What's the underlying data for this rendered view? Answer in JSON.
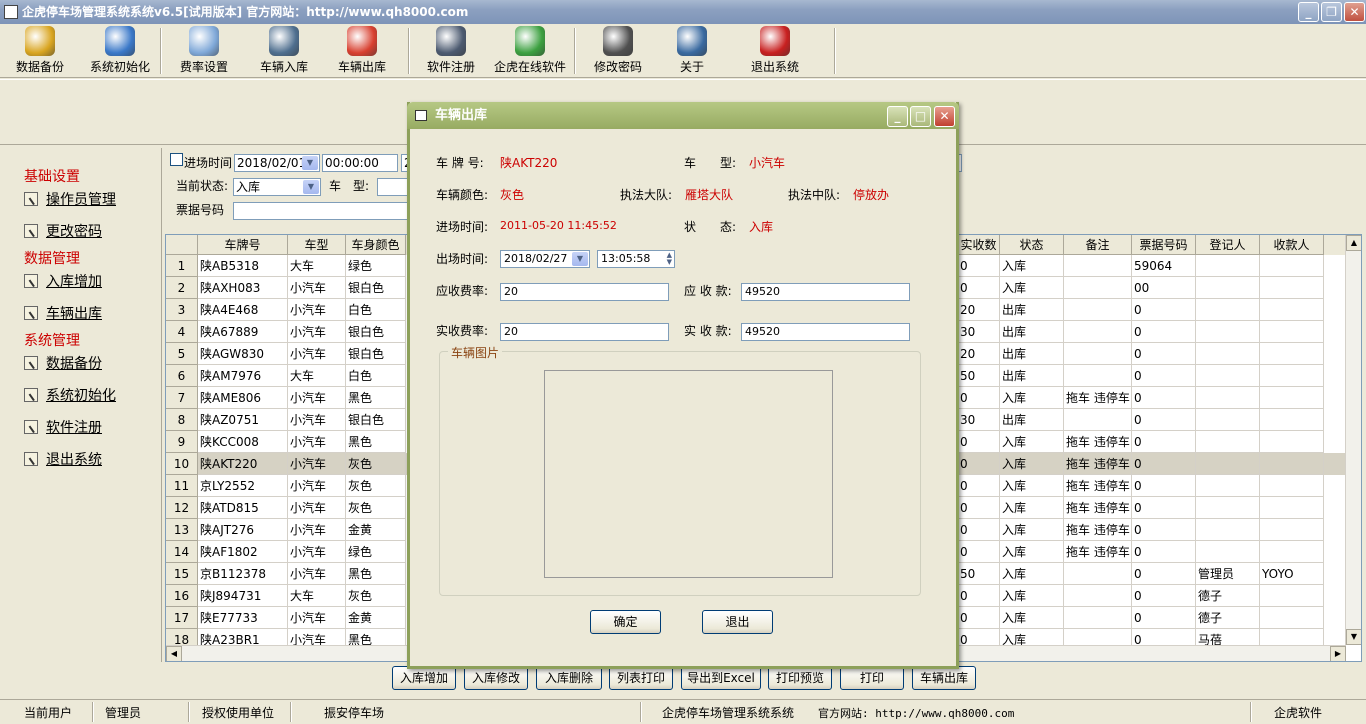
{
  "window": {
    "title": "企虎停车场管理系统系统v6.5[试用版本] 官方网站：http://www.qh8000.com"
  },
  "toolbar": {
    "items": [
      {
        "label": "数据备份",
        "icon": "database-icon",
        "color": "#d9a520"
      },
      {
        "label": "系统初始化",
        "icon": "init-icon",
        "color": "#3a78c8"
      },
      {
        "label": "费率设置",
        "icon": "magnifier-icon",
        "color": "#7fa8d8"
      },
      {
        "label": "车辆入库",
        "icon": "car-in-icon",
        "color": "#4f6f8f"
      },
      {
        "label": "车辆出库",
        "icon": "car-out-icon",
        "color": "#d84030"
      },
      {
        "label": "软件注册",
        "icon": "register-icon",
        "color": "#4c5a70"
      },
      {
        "label": "企虎在线软件",
        "icon": "refresh-icon",
        "color": "#3ca040"
      },
      {
        "label": "修改密码",
        "icon": "key-icon",
        "color": "#505050"
      },
      {
        "label": "关于",
        "icon": "about-icon",
        "color": "#3a6aa0"
      },
      {
        "label": "退出系统",
        "icon": "exit-icon",
        "color": "#c82020"
      }
    ]
  },
  "sidebar": {
    "sections": [
      {
        "title": "基础设置",
        "items": [
          "操作员管理",
          "更改密码"
        ]
      },
      {
        "title": "数据管理",
        "items": [
          "入库增加",
          "车辆出库"
        ]
      },
      {
        "title": "系统管理",
        "items": [
          "数据备份",
          "系统初始化",
          "软件注册",
          "退出系统"
        ]
      }
    ]
  },
  "filter": {
    "entry_time_label": "进场时间",
    "entry_date": "2018/02/01",
    "entry_time": "00:00:00",
    "entry_date2_partial": "2",
    "status_label": "当前状态:",
    "status_value": "入库",
    "type_label": "车　型:",
    "ticket_label": "票据号码"
  },
  "grid": {
    "columns_left": [
      "车牌号",
      "车型",
      "车身颜色"
    ],
    "columns_right": [
      "实收数",
      "状态",
      "备注",
      "票据号码",
      "登记人",
      "收款人"
    ],
    "rows": [
      {
        "n": "1",
        "plate": "陕AB5318",
        "type": "大车",
        "color": "绿色",
        "paid": "0",
        "status": "入库",
        "note": "",
        "ticket": "59064",
        "reg": "",
        "cashier": ""
      },
      {
        "n": "2",
        "plate": "陕AXH083",
        "type": "小汽车",
        "color": "银白色",
        "paid": "0",
        "status": "入库",
        "note": "",
        "ticket": "00",
        "reg": "",
        "cashier": ""
      },
      {
        "n": "3",
        "plate": "陕A4E468",
        "type": "小汽车",
        "color": "白色",
        "paid": "20",
        "status": "出库",
        "note": "",
        "ticket": "0",
        "reg": "",
        "cashier": ""
      },
      {
        "n": "4",
        "plate": "陕A67889",
        "type": "小汽车",
        "color": "银白色",
        "paid": "30",
        "status": "出库",
        "note": "",
        "ticket": "0",
        "reg": "",
        "cashier": ""
      },
      {
        "n": "5",
        "plate": "陕AGW830",
        "type": "小汽车",
        "color": "银白色",
        "paid": "20",
        "status": "出库",
        "note": "",
        "ticket": "0",
        "reg": "",
        "cashier": ""
      },
      {
        "n": "6",
        "plate": "陕AM7976",
        "type": "大车",
        "color": "白色",
        "paid": "50",
        "status": "出库",
        "note": "",
        "ticket": "0",
        "reg": "",
        "cashier": ""
      },
      {
        "n": "7",
        "plate": "陕AME806",
        "type": "小汽车",
        "color": "黑色",
        "paid": "0",
        "status": "入库",
        "note": "拖车 违停车",
        "ticket": "0",
        "reg": "",
        "cashier": ""
      },
      {
        "n": "8",
        "plate": "陕AZ0751",
        "type": "小汽车",
        "color": "银白色",
        "paid": "30",
        "status": "出库",
        "note": "",
        "ticket": "0",
        "reg": "",
        "cashier": ""
      },
      {
        "n": "9",
        "plate": "陕KCC008",
        "type": "小汽车",
        "color": "黑色",
        "paid": "0",
        "status": "入库",
        "note": "拖车 违停车",
        "ticket": "0",
        "reg": "",
        "cashier": ""
      },
      {
        "n": "10",
        "plate": "陕AKT220",
        "type": "小汽车",
        "color": "灰色",
        "paid": "0",
        "status": "入库",
        "note": "拖车 违停车",
        "ticket": "0",
        "reg": "",
        "cashier": ""
      },
      {
        "n": "11",
        "plate": "京LY2552",
        "type": "小汽车",
        "color": "灰色",
        "paid": "0",
        "status": "入库",
        "note": "拖车 违停车",
        "ticket": "0",
        "reg": "",
        "cashier": ""
      },
      {
        "n": "12",
        "plate": "陕ATD815",
        "type": "小汽车",
        "color": "灰色",
        "paid": "0",
        "status": "入库",
        "note": "拖车 违停车",
        "ticket": "0",
        "reg": "",
        "cashier": ""
      },
      {
        "n": "13",
        "plate": "陕AJT276",
        "type": "小汽车",
        "color": "金黄",
        "paid": "0",
        "status": "入库",
        "note": "拖车 违停车",
        "ticket": "0",
        "reg": "",
        "cashier": ""
      },
      {
        "n": "14",
        "plate": "陕AF1802",
        "type": "小汽车",
        "color": "绿色",
        "paid": "0",
        "status": "入库",
        "note": "拖车 违停车",
        "ticket": "0",
        "reg": "",
        "cashier": ""
      },
      {
        "n": "15",
        "plate": "京B112378",
        "type": "小汽车",
        "color": "黑色",
        "paid": "50",
        "status": "入库",
        "note": "",
        "ticket": "0",
        "reg": "管理员",
        "cashier": "YOYO"
      },
      {
        "n": "16",
        "plate": "陕J894731",
        "type": "大车",
        "color": "灰色",
        "paid": "0",
        "status": "入库",
        "note": "",
        "ticket": "0",
        "reg": "德子",
        "cashier": ""
      },
      {
        "n": "17",
        "plate": "陕E77733",
        "type": "小汽车",
        "color": "金黄",
        "paid": "0",
        "status": "入库",
        "note": "",
        "ticket": "0",
        "reg": "德子",
        "cashier": ""
      },
      {
        "n": "18",
        "plate": "陕A23BR1",
        "type": "小汽车",
        "color": "黑色",
        "paid": "0",
        "status": "入库",
        "note": "",
        "ticket": "0",
        "reg": "马蓓",
        "cashier": ""
      }
    ]
  },
  "bottom_buttons": [
    "入库增加",
    "入库修改",
    "入库删除",
    "列表打印",
    "导出到Excel",
    "打印预览",
    "打印",
    "车辆出库"
  ],
  "statusbar": {
    "current_user_label": "当前用户",
    "current_user": "管理员",
    "licensee_label": "授权使用单位",
    "licensee": "振安停车场",
    "product": "企虎停车场管理系统系统",
    "website": "官方网站: http://www.qh8000.com",
    "vendor": "企虎软件"
  },
  "dialog": {
    "title": "车辆出库",
    "plate_label": "车 牌 号:",
    "plate": "陕AKT220",
    "type_label": "车　　型:",
    "type": "小汽车",
    "color_label": "车辆颜色:",
    "color": "灰色",
    "brigade_label": "执法大队:",
    "brigade": "雁塔大队",
    "squad_label": "执法中队:",
    "squad": "停放办",
    "entry_label": "进场时间:",
    "entry": "2011-05-20 11:45:52",
    "state_label": "状　　态:",
    "state": "入库",
    "exit_label": "出场时间:",
    "exit_date": "2018/02/27",
    "exit_time": "13:05:58",
    "due_fee_label": "应收费率:",
    "due_fee": "20",
    "due_amount_label": "应 收 款:",
    "due_amount": "49520",
    "paid_fee_label": "实收费率:",
    "paid_fee": "20",
    "paid_amount_label": "实 收 款:",
    "paid_amount": "49520",
    "picture_label": "车辆图片",
    "ok": "确定",
    "exit": "退出"
  }
}
